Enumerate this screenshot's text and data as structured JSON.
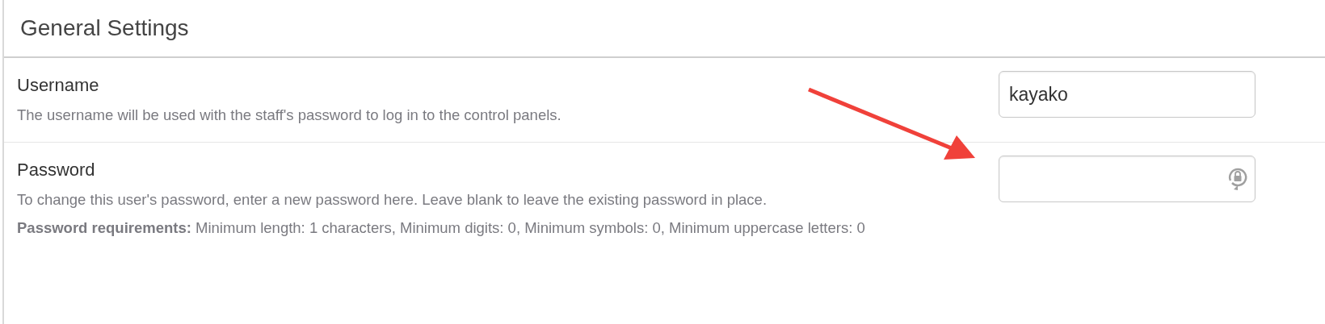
{
  "section": {
    "title": "General Settings"
  },
  "fields": [
    {
      "kind": "text",
      "label": "Username",
      "description": "The username will be used with the staff's password to log in to the control panels.",
      "value": "kayako"
    },
    {
      "kind": "password",
      "label": "Password",
      "description": "To change this user's password, enter a new password here. Leave blank to leave the existing password in place.",
      "requirements": "**Password requirements:** Minimum length: 1 characters, Minimum digits: 0, Minimum symbols: 0, Minimum uppercase letters: 0"
    }
  ]
}
